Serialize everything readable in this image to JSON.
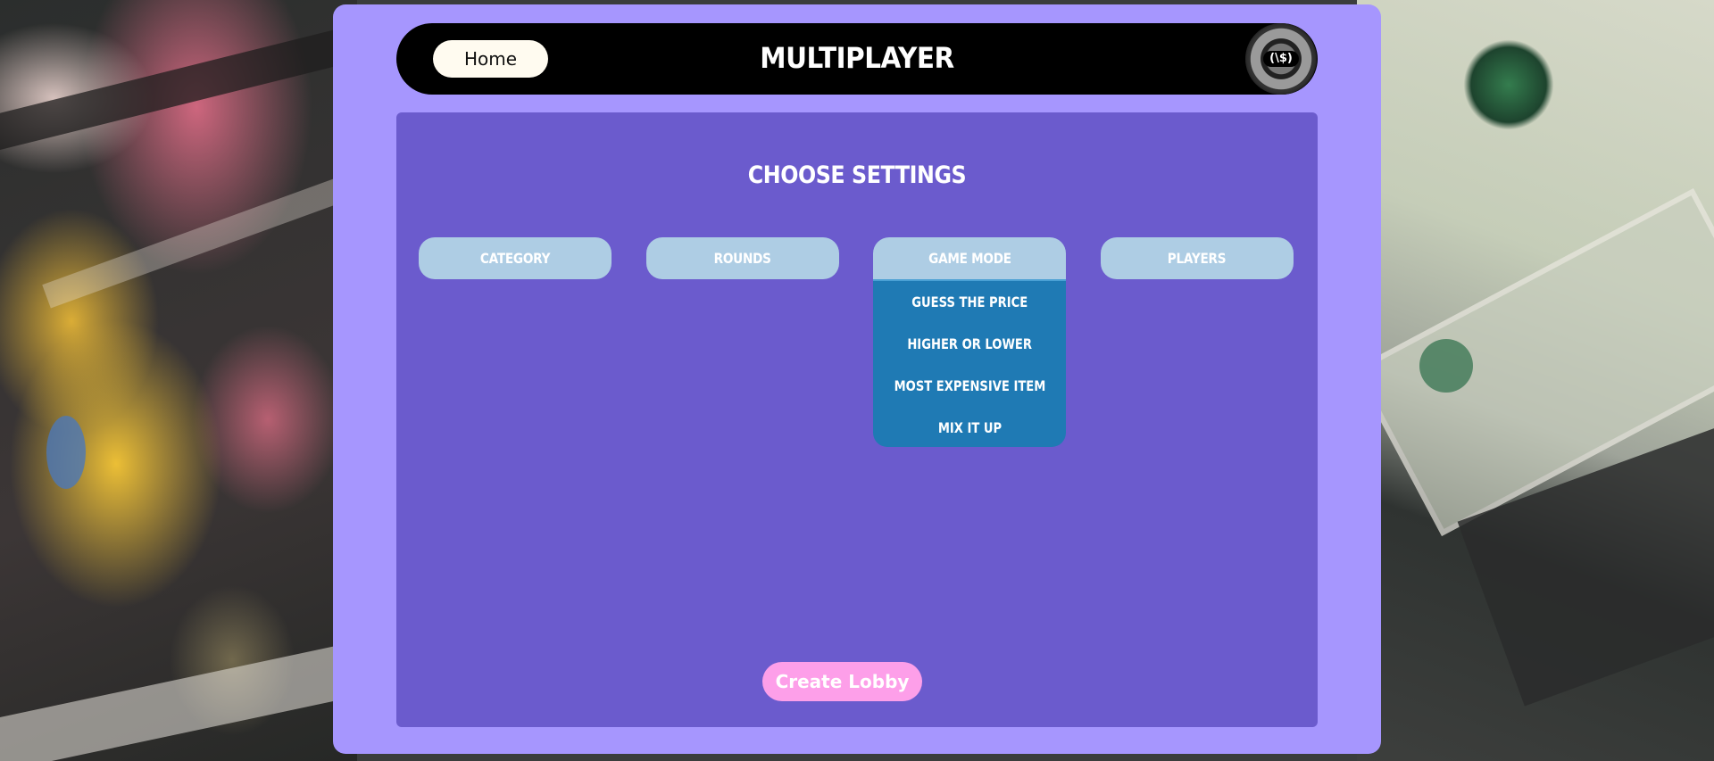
{
  "nav": {
    "home_label": "Home",
    "title": "MULTIPLAYER",
    "logo_icon": "dollar-coin-logo-icon"
  },
  "settings": {
    "heading": "CHOOSE SETTINGS",
    "buttons": {
      "category": "CATEGORY",
      "rounds": "ROUNDS",
      "game_mode": "GAME MODE",
      "players": "PLAYERS"
    },
    "game_mode_options": [
      "GUESS THE PRICE",
      "HIGHER OR LOWER",
      "MOST EXPENSIVE ITEM",
      "MIX IT UP"
    ]
  },
  "actions": {
    "create_lobby_label": "Create Lobby"
  },
  "colors": {
    "card": "#a696fe",
    "panel": "#6b5bcd",
    "nav": "#000000",
    "setting_button": "#aecde4",
    "dropdown": "#1f7ab4",
    "create_button": "#fd9fe9",
    "home_button": "#fffbf0"
  }
}
